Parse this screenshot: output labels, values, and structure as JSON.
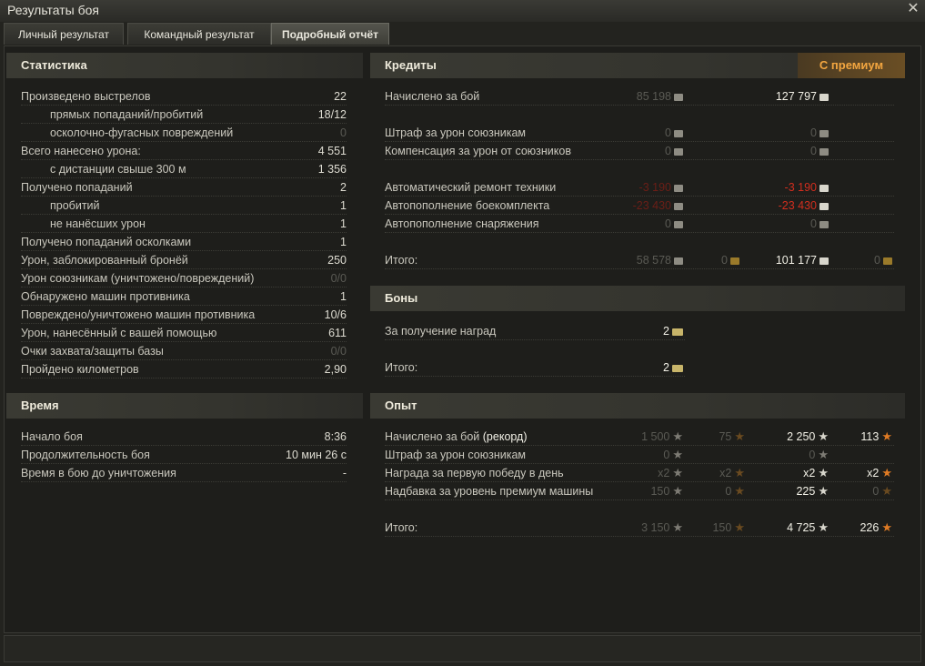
{
  "window": {
    "title": "Результаты боя"
  },
  "tabs": [
    "Личный результат",
    "Командный результат",
    "Подробный отчёт"
  ],
  "stats": {
    "header": "Статистика",
    "rows": [
      {
        "label": "Произведено выстрелов",
        "value": "22"
      },
      {
        "label": "прямых попаданий/пробитий",
        "value": "18/12"
      },
      {
        "label": "осколочно-фугасных повреждений",
        "value": "0"
      },
      {
        "label": "Всего нанесено урона:",
        "value": "4 551"
      },
      {
        "label": "с дистанции свыше 300 м",
        "value": "1 356"
      },
      {
        "label": "Получено попаданий",
        "value": "2"
      },
      {
        "label": "пробитий",
        "value": "1"
      },
      {
        "label": "не нанёсших урон",
        "value": "1"
      },
      {
        "label": "Получено попаданий осколками",
        "value": "1"
      },
      {
        "label": "Урон, заблокированный бронёй",
        "value": "250"
      },
      {
        "label": "Урон союзникам (уничтожено/повреждений)",
        "value": "0/0"
      },
      {
        "label": "Обнаружено машин противника",
        "value": "1"
      },
      {
        "label": "Повреждено/уничтожено машин противника",
        "value": "10/6"
      },
      {
        "label": "Урон, нанесённый с вашей помощью",
        "value": "611"
      },
      {
        "label": "Очки захвата/защиты базы",
        "value": "0/0"
      },
      {
        "label": "Пройдено километров",
        "value": "2,90"
      }
    ]
  },
  "time": {
    "header": "Время",
    "rows": [
      {
        "label": "Начало боя",
        "value": "8:36"
      },
      {
        "label": "Продолжительность боя",
        "value": "10 мин 26 с"
      },
      {
        "label": "Время в бою до уничтожения",
        "value": "-"
      }
    ]
  },
  "credits": {
    "header": "Кредиты",
    "premium_label": "С премиум",
    "rows": [
      {
        "label": "Начислено за бой",
        "base": "85 198",
        "prem": "127 797"
      },
      {
        "label": "Штраф за урон союзникам",
        "base": "0",
        "prem": "0"
      },
      {
        "label": "Компенсация за урон от союзников",
        "base": "0",
        "prem": "0"
      },
      {
        "label": "Автоматический ремонт техники",
        "base": "-3 190",
        "prem": "-3 190"
      },
      {
        "label": "Автопополнение боекомплекта",
        "base": "-23 430",
        "prem": "-23 430"
      },
      {
        "label": "Автопополнение снаряжения",
        "base": "0",
        "prem": "0"
      },
      {
        "label": "Итого:",
        "base": "58 578",
        "base_gold": "0",
        "prem": "101 177",
        "prem_gold": "0"
      }
    ]
  },
  "bonds": {
    "header": "Боны",
    "rows": [
      {
        "label": "За получение наград",
        "value": "2"
      },
      {
        "label": "Итого:",
        "value": "2"
      }
    ]
  },
  "xp": {
    "header": "Опыт",
    "rows": [
      {
        "label": "Начислено за бой",
        "label_extra": "(рекорд)",
        "base": "1 500",
        "base_free": "75",
        "prem": "2 250",
        "prem_free": "113"
      },
      {
        "label": "Штраф за урон союзникам",
        "label_extra": "",
        "base": "0",
        "base_free": "",
        "prem": "0",
        "prem_free": ""
      },
      {
        "label": "Награда за первую победу в день",
        "label_extra": "",
        "base": "x2",
        "base_free": "x2",
        "prem": "x2",
        "prem_free": "x2"
      },
      {
        "label": "Надбавка за уровень премиум машины",
        "label_extra": "",
        "base": "150",
        "base_free": "0",
        "prem": "225",
        "prem_free": "0"
      },
      {
        "label": "Итого:",
        "label_extra": "",
        "base": "3 150",
        "base_free": "150",
        "prem": "4 725",
        "prem_free": "226"
      }
    ]
  },
  "icons": {
    "close": "close-icon",
    "credit": "credit-icon",
    "gold": "gold-icon",
    "xp": "xp-star-icon",
    "free_xp": "free-xp-star-icon",
    "bond": "bond-icon"
  },
  "colors": {
    "premium_accent": "#f3a640",
    "negative": "#d22e1e",
    "free_xp_star": "#e07b24"
  }
}
